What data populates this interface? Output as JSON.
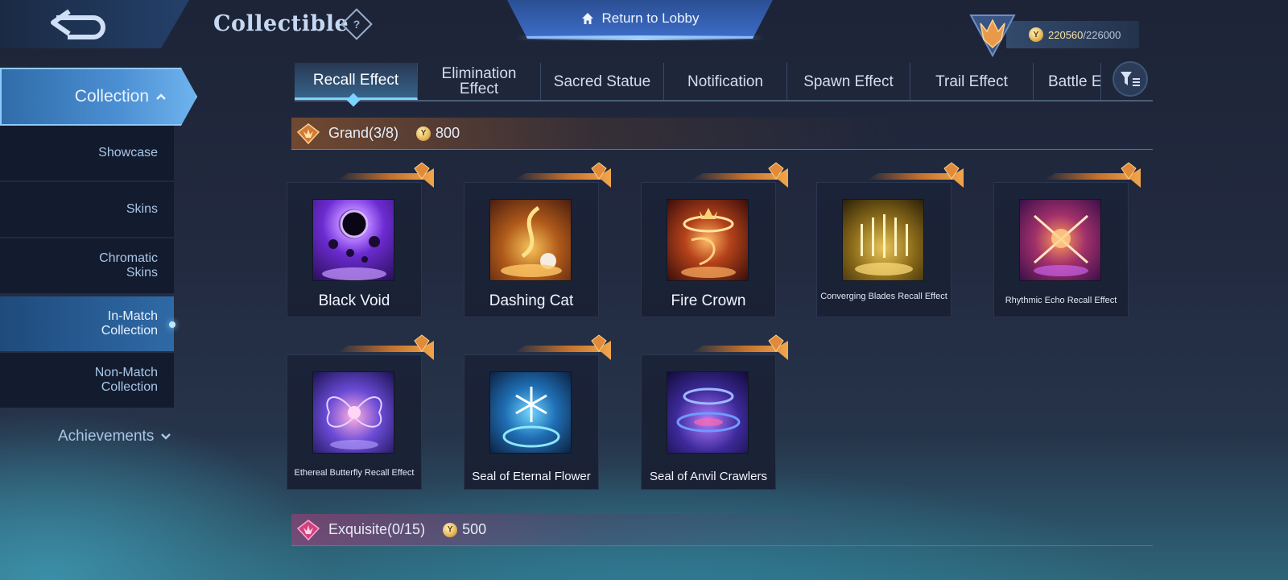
{
  "header": {
    "title": "Collectible",
    "help_symbol": "?",
    "lobby_label": "Return to Lobby",
    "currency": {
      "value": "220560",
      "separator": "/",
      "max": "226000"
    }
  },
  "sidebar": {
    "collection_label": "Collection",
    "items": [
      {
        "label": "Showcase"
      },
      {
        "label": "Skins"
      },
      {
        "label": "Chromatic Skins"
      },
      {
        "label": "In-Match Collection"
      },
      {
        "label": "Non-Match Collection"
      }
    ],
    "achievements_label": "Achievements"
  },
  "tabs": [
    {
      "label": "Recall Effect"
    },
    {
      "label": "Elimination Effect"
    },
    {
      "label": "Sacred Statue"
    },
    {
      "label": "Notification"
    },
    {
      "label": "Spawn Effect"
    },
    {
      "label": "Trail Effect"
    },
    {
      "label": "Battle E"
    }
  ],
  "sections": {
    "grand": {
      "label": "Grand(3/8)",
      "cost": "800"
    },
    "exquisite": {
      "label": "Exquisite(0/15)",
      "cost": "500"
    }
  },
  "cards": [
    {
      "name": "Black Void"
    },
    {
      "name": "Dashing Cat"
    },
    {
      "name": "Fire Crown"
    },
    {
      "name": "Converging Blades Recall Effect"
    },
    {
      "name": "Rhythmic Echo Recall Effect"
    },
    {
      "name": "Ethereal Butterfly Recall Effect"
    },
    {
      "name": "Seal of Eternal Flower"
    },
    {
      "name": "Seal of Anvil Crawlers"
    }
  ]
}
